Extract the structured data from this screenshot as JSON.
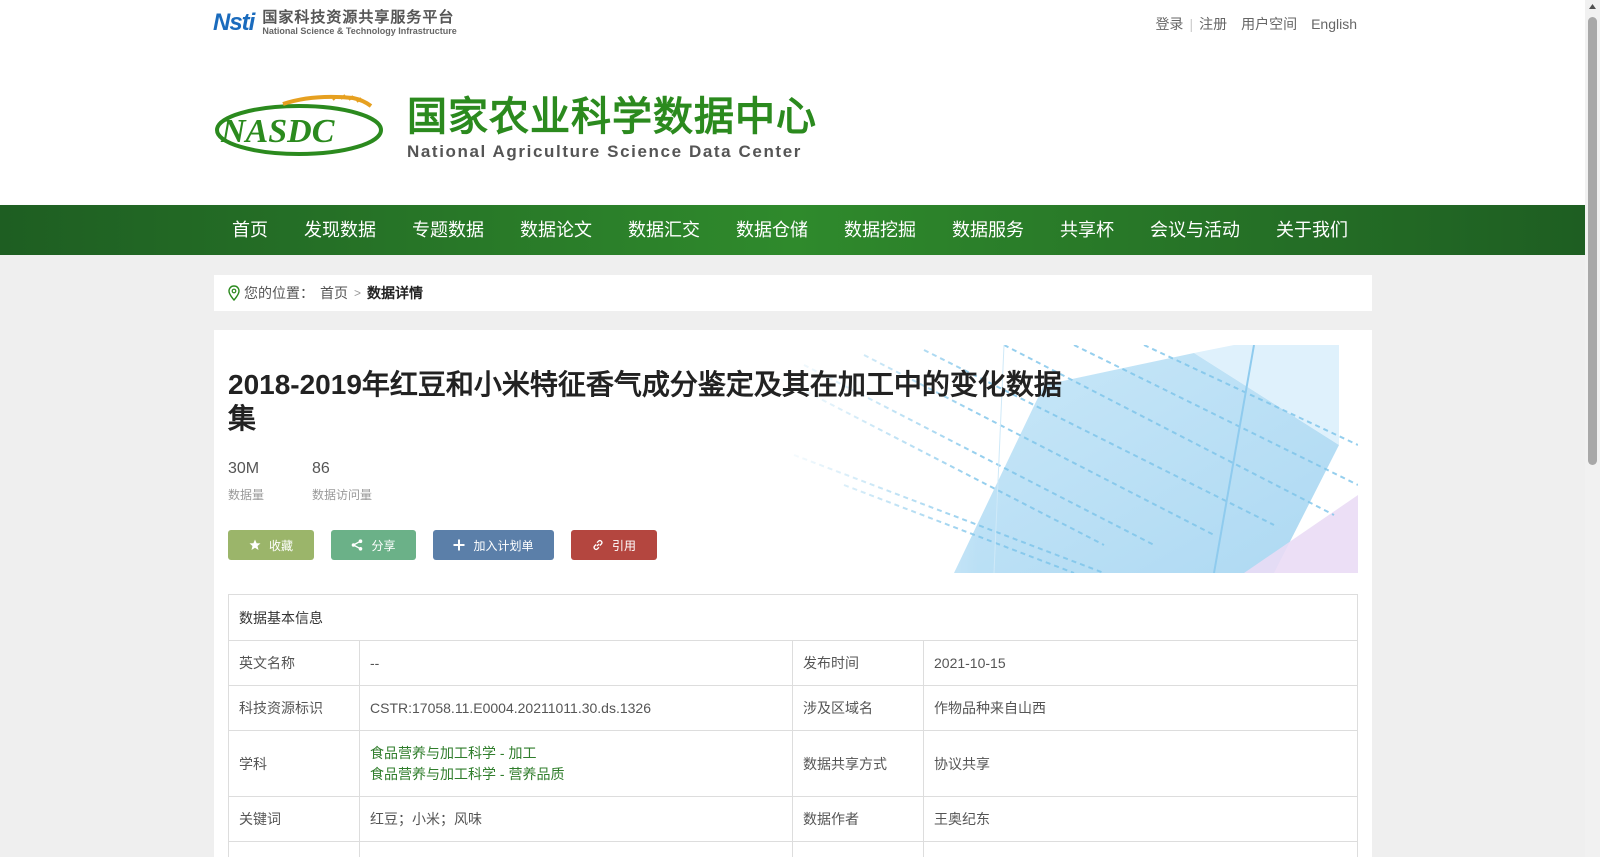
{
  "topbar": {
    "platform_mark": "Nsti",
    "platform_cn": "国家科技资源共享服务平台",
    "platform_en": "National Science & Technology Infrastructure",
    "links": {
      "login": "登录",
      "register": "注册",
      "user_space": "用户空间",
      "english": "English"
    }
  },
  "header": {
    "logo_text": "NASDC",
    "title_cn": "国家农业科学数据中心",
    "title_en": "National Agriculture Science Data Center"
  },
  "nav": {
    "items": [
      "首页",
      "发现数据",
      "专题数据",
      "数据论文",
      "数据汇交",
      "数据仓储",
      "数据挖掘",
      "数据服务",
      "共享杯",
      "会议与活动",
      "关于我们"
    ]
  },
  "breadcrumb": {
    "prefix": "您的位置：",
    "home": "首页",
    "separator": ">",
    "current": "数据详情"
  },
  "dataset": {
    "title": "2018-2019年红豆和小米特征香气成分鉴定及其在加工中的变化数据集",
    "stats": {
      "size_value": "30M",
      "size_label": "数据量",
      "visits_value": "86",
      "visits_label": "数据访问量"
    },
    "buttons": {
      "favorite": "收藏",
      "share": "分享",
      "add_plan": "加入计划单",
      "cite": "引用"
    }
  },
  "info_table": {
    "heading": "数据基本信息",
    "en_name_label": "英文名称",
    "en_name_value": "--",
    "publish_label": "发布时间",
    "publish_value": "2021-10-15",
    "id_label": "科技资源标识",
    "id_value": "CSTR:17058.11.E0004.20211011.30.ds.1326",
    "region_label": "涉及区域名",
    "region_value": "作物品种来自山西",
    "subject_label": "学科",
    "subjects": [
      "食品营养与加工科学 - 加工",
      "食品营养与加工科学 - 营养品质"
    ],
    "share_label": "数据共享方式",
    "share_value": "协议共享",
    "keywords_label": "关键词",
    "keywords_value": "红豆；小米；风味",
    "author_label": "数据作者",
    "author_value": "王奥纪东"
  },
  "colors": {
    "nav_green": "#2f8a2c",
    "brand_green": "#2b8a1e",
    "fav": "#9bb56a",
    "share": "#6bb188",
    "plan": "#5b7fa9",
    "cite": "#b4463f",
    "link_green": "#2f7d2b"
  }
}
